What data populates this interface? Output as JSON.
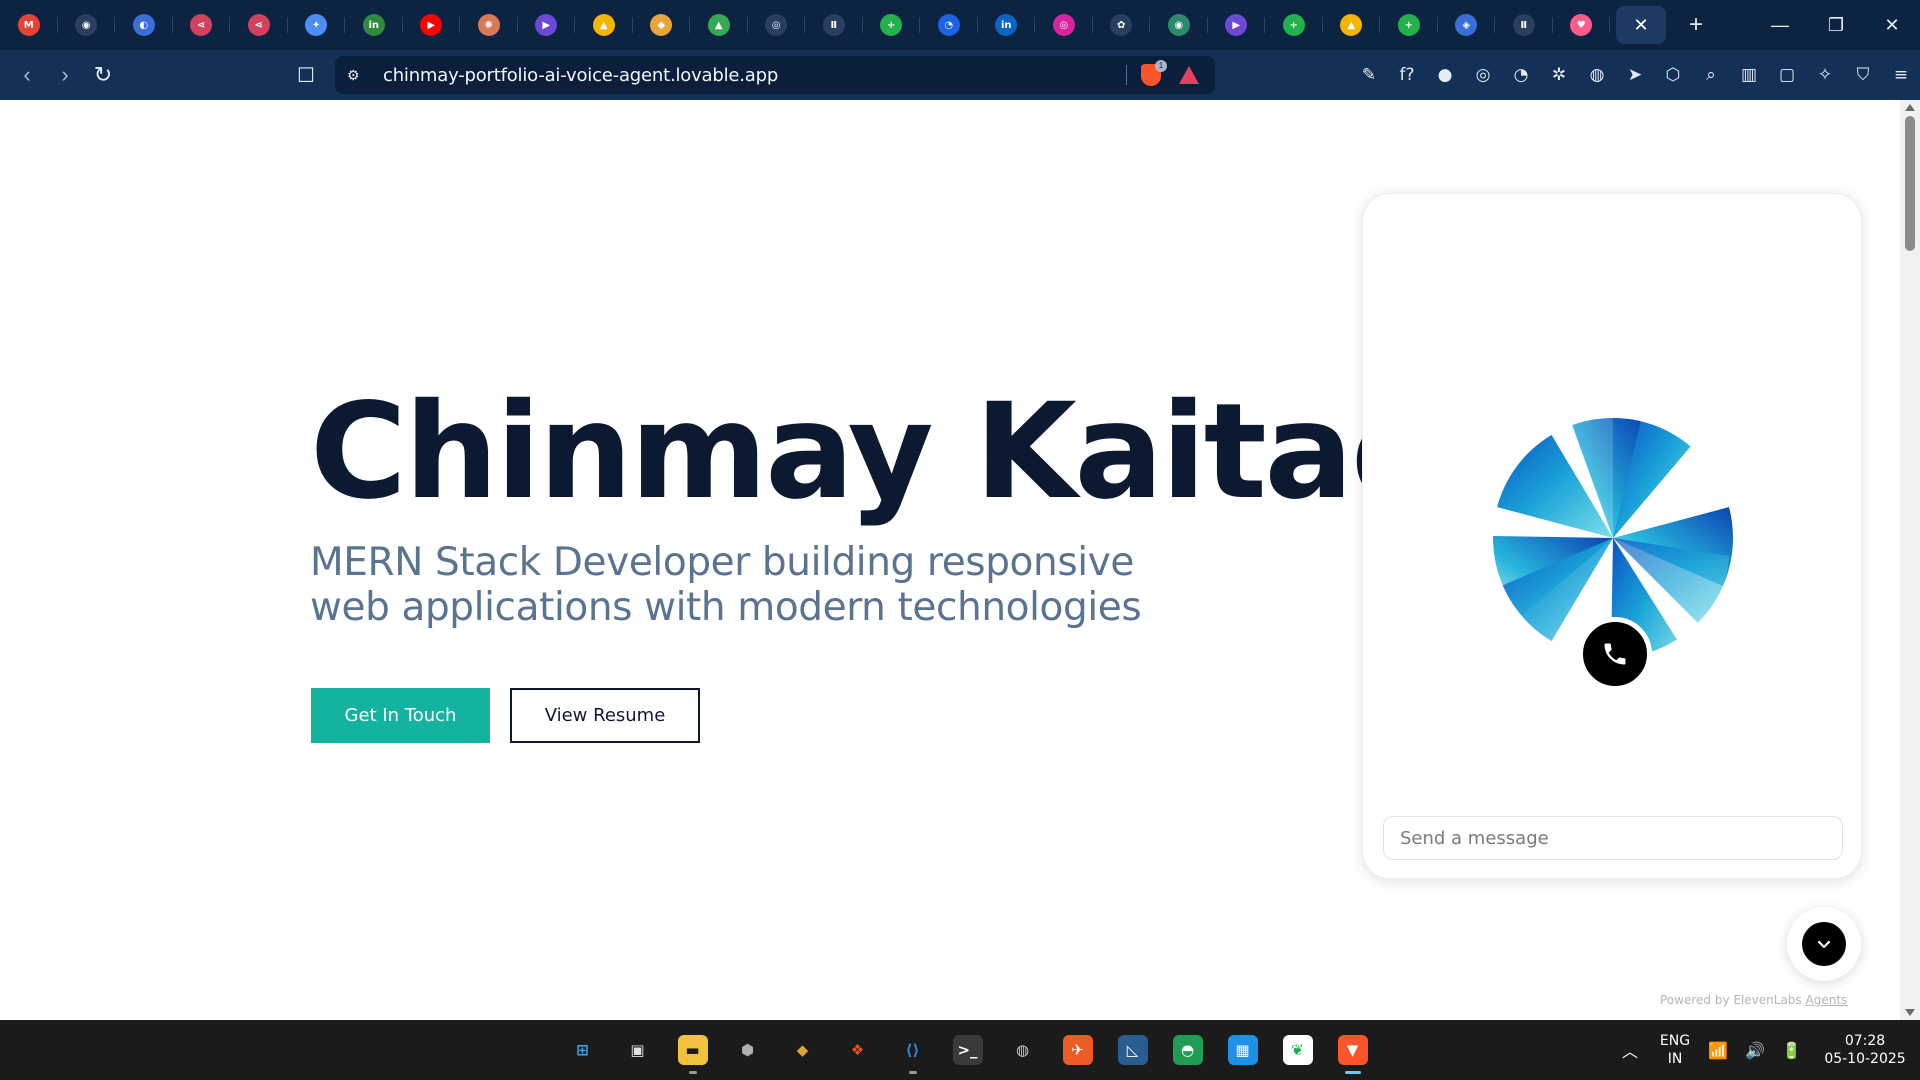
{
  "browser": {
    "tabs": [
      {
        "icon": "gmail-icon",
        "glyph": "M",
        "color": "#e94235"
      },
      {
        "icon": "github-icon",
        "glyph": "◉",
        "color": "#ffffff"
      },
      {
        "icon": "app-icon",
        "glyph": "◐",
        "color": "#3b6fd8"
      },
      {
        "icon": "share-icon",
        "glyph": "⋖",
        "color": "#d1425e"
      },
      {
        "icon": "share-icon",
        "glyph": "⋖",
        "color": "#d1425e"
      },
      {
        "icon": "gemini-icon",
        "glyph": "✦",
        "color": "#4c8df6"
      },
      {
        "icon": "linkedin-learning-icon",
        "glyph": "in",
        "color": "#2f8a3f"
      },
      {
        "icon": "youtube-icon",
        "glyph": "▶",
        "color": "#ff0000"
      },
      {
        "icon": "claude-icon",
        "glyph": "✺",
        "color": "#d97757"
      },
      {
        "icon": "play-icon",
        "glyph": "▶",
        "color": "#6b48d6"
      },
      {
        "icon": "drive-icon",
        "glyph": "▲",
        "color": "#f4b400"
      },
      {
        "icon": "cube-icon",
        "glyph": "◆",
        "color": "#e8a53b"
      },
      {
        "icon": "drive-icon",
        "glyph": "▲",
        "color": "#34a853"
      },
      {
        "icon": "openai-icon",
        "glyph": "◎",
        "color": "#ffffff"
      },
      {
        "icon": "pause-icon",
        "glyph": "Ⅱ",
        "color": "#ffffff"
      },
      {
        "icon": "plus-icon",
        "glyph": "+",
        "color": "#22b14c"
      },
      {
        "icon": "search-icon",
        "glyph": "◔",
        "color": "#1e62e6"
      },
      {
        "icon": "linkedin-icon",
        "glyph": "in",
        "color": "#0a66c2"
      },
      {
        "icon": "instagram-icon",
        "glyph": "◎",
        "color": "#d6249f"
      },
      {
        "icon": "openai-icon",
        "glyph": "✿",
        "color": "#ffffff"
      },
      {
        "icon": "app-icon",
        "glyph": "◉",
        "color": "#2b8a6a"
      },
      {
        "icon": "play-icon",
        "glyph": "▶",
        "color": "#6b48d6"
      },
      {
        "icon": "plus-icon",
        "glyph": "+",
        "color": "#22b14c"
      },
      {
        "icon": "drive-icon",
        "glyph": "▲",
        "color": "#f4b400"
      },
      {
        "icon": "plus-icon",
        "glyph": "+",
        "color": "#22b14c"
      },
      {
        "icon": "shield-icon",
        "glyph": "◈",
        "color": "#3b6fd8"
      },
      {
        "icon": "pause-icon",
        "glyph": "Ⅱ",
        "color": "#ffffff"
      },
      {
        "icon": "lovable-icon",
        "glyph": "♥",
        "color": "#ff5c8a"
      }
    ],
    "active_tab_close": "✕",
    "new_tab": "+",
    "window_controls": {
      "minimize": "—",
      "restore": "❐",
      "close": "✕"
    },
    "nav": {
      "back": "‹",
      "forward": "›",
      "reload": "↻"
    },
    "bookmark": "☐",
    "url": "chinmay-portfolio-ai-voice-agent.lovable.app",
    "shield_count": "1",
    "extensions": [
      "✎",
      "f?",
      "●",
      "◎",
      "◔",
      "✲",
      "◍",
      "➤",
      "⬡",
      "⌕",
      "▥",
      "▢",
      "✧",
      "⛉",
      "≡"
    ]
  },
  "hero": {
    "name": "Chinmay Kaitade",
    "subtitle": "MERN Stack Developer building responsive web applications with modern technologies",
    "cta_primary": "Get In Touch",
    "cta_secondary": "View Resume"
  },
  "voice_widget": {
    "message_placeholder": "Send a message",
    "powered_by": "Powered by ElevenLabs",
    "powered_link": "Agents"
  },
  "taskbar": {
    "apps": [
      {
        "name": "windows-start-icon",
        "glyph": "⊞",
        "bg": "#1b1b1b",
        "color": "#39a8f0",
        "dot": ""
      },
      {
        "name": "task-view-icon",
        "glyph": "▣",
        "bg": "#1b1b1b",
        "color": "#e0e0e0",
        "dot": ""
      },
      {
        "name": "file-explorer-icon",
        "glyph": "▬",
        "bg": "#f3c23c",
        "color": "#1b1b1b",
        "dot": "open"
      },
      {
        "name": "unity-icon",
        "glyph": "⬢",
        "bg": "#1b1b1b",
        "color": "#b0b0b0",
        "dot": ""
      },
      {
        "name": "git-icon",
        "glyph": "◆",
        "bg": "#1b1b1b",
        "color": "#e0a33a",
        "dot": ""
      },
      {
        "name": "figma-icon",
        "glyph": "❖",
        "bg": "#1b1b1b",
        "color": "#f24e1e",
        "dot": ""
      },
      {
        "name": "vscode-icon",
        "glyph": "⟨⟩",
        "bg": "#1b1b1b",
        "color": "#2f8ad8",
        "dot": "open"
      },
      {
        "name": "terminal-icon",
        "glyph": ">_",
        "bg": "#3a3a3a",
        "color": "#ffffff",
        "dot": ""
      },
      {
        "name": "obs-icon",
        "glyph": "◍",
        "bg": "#1b1b1b",
        "color": "#d0d0d0",
        "dot": ""
      },
      {
        "name": "postman-icon",
        "glyph": "✈",
        "bg": "#ef5b25",
        "color": "#ffffff",
        "dot": ""
      },
      {
        "name": "mysql-icon",
        "glyph": "◺",
        "bg": "#2a5d8f",
        "color": "#ffffff",
        "dot": ""
      },
      {
        "name": "gitkraken-icon",
        "glyph": "◓",
        "bg": "#1f9d55",
        "color": "#ffffff",
        "dot": ""
      },
      {
        "name": "docker-icon",
        "glyph": "▦",
        "bg": "#1d91e6",
        "color": "#ffffff",
        "dot": ""
      },
      {
        "name": "mongodb-icon",
        "glyph": "❦",
        "bg": "#ffffff",
        "color": "#13aa52",
        "dot": ""
      },
      {
        "name": "brave-icon",
        "glyph": "▼",
        "bg": "#fb542b",
        "color": "#ffffff",
        "dot": "active"
      }
    ],
    "tray_chevron": "︿",
    "lang": "ENG",
    "region": "IN",
    "wifi": "📶",
    "volume": "🔊",
    "battery": "🔋",
    "time": "07:28",
    "date": "05-10-2025"
  }
}
